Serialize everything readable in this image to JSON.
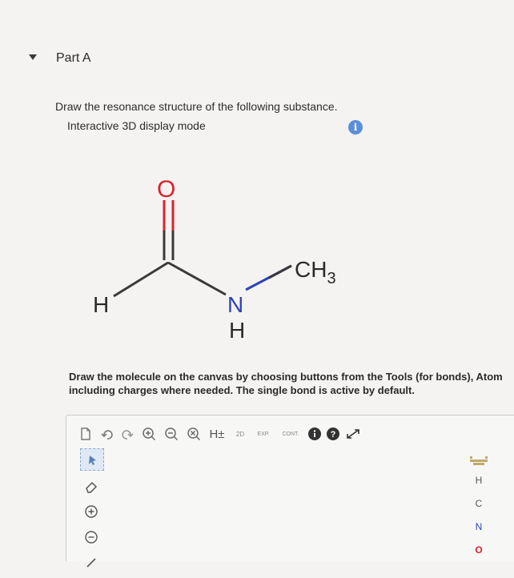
{
  "part": {
    "title": "Part A"
  },
  "question": {
    "text": "Draw the resonance structure of the following substance.",
    "mode": "Interactive 3D display mode"
  },
  "molecule": {
    "atoms": {
      "o": "O",
      "h_left": "H",
      "n": "N",
      "h_n": "H",
      "ch3": "CH",
      "ch3_sub": "3"
    }
  },
  "instructions": {
    "line1": "Draw the molecule on the canvas by choosing buttons from the Tools (for bonds), Atom",
    "line2": "including charges where needed. The single bond is active by default."
  },
  "toolbar": {
    "h_label": "H±",
    "label_2d": "2D",
    "exp_label": "EXP.",
    "cont_label": "CONT."
  },
  "atom_panel": {
    "items": [
      "H",
      "C",
      "N",
      "O"
    ]
  },
  "colors": {
    "accent_blue": "#5b8fd6",
    "oxygen_red": "#d9232e",
    "nitrogen_blue": "#2f43b6",
    "dark_badge": "#333333"
  }
}
